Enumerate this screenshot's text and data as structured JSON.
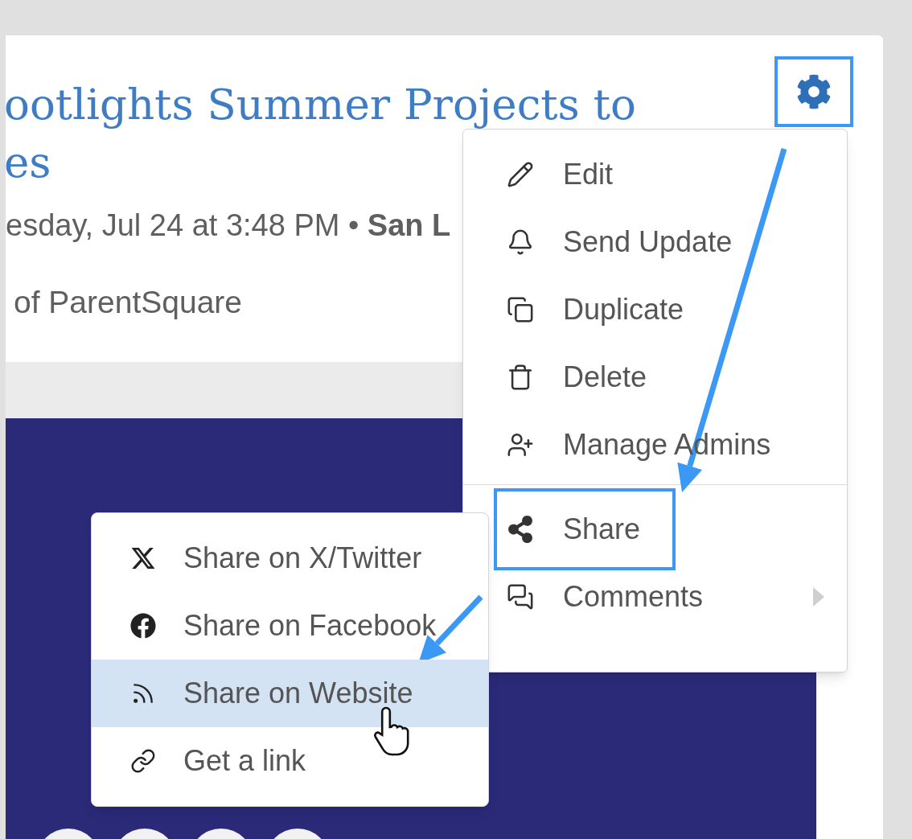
{
  "post": {
    "title_lines": [
      "ootlights Summer Projects to",
      "es"
    ],
    "date_line": "esday, Jul 24 at 3:48 PM • **San L**",
    "byline": "of ParentSquare"
  },
  "settings_button": {
    "annotated": true
  },
  "menu": {
    "groups": [
      [
        {
          "label": "Edit",
          "annotated": false,
          "has_submenu": false
        },
        {
          "label": "Send Update",
          "annotated": false,
          "has_submenu": false
        },
        {
          "label": "Duplicate",
          "annotated": false,
          "has_submenu": false
        },
        {
          "label": "Delete",
          "annotated": false,
          "has_submenu": false
        },
        {
          "label": "Manage Admins",
          "annotated": false,
          "has_submenu": false
        }
      ],
      [
        {
          "label": "Share",
          "annotated": true,
          "has_submenu": false
        },
        {
          "label": "Comments",
          "annotated": false,
          "has_submenu": true
        }
      ]
    ]
  },
  "share_submenu": {
    "items": [
      {
        "label": "Share on X/Twitter",
        "selected": false
      },
      {
        "label": "Share on Facebook",
        "selected": false
      },
      {
        "label": "Share on Website",
        "selected": true
      },
      {
        "label": "Get a link",
        "selected": false
      }
    ]
  }
}
